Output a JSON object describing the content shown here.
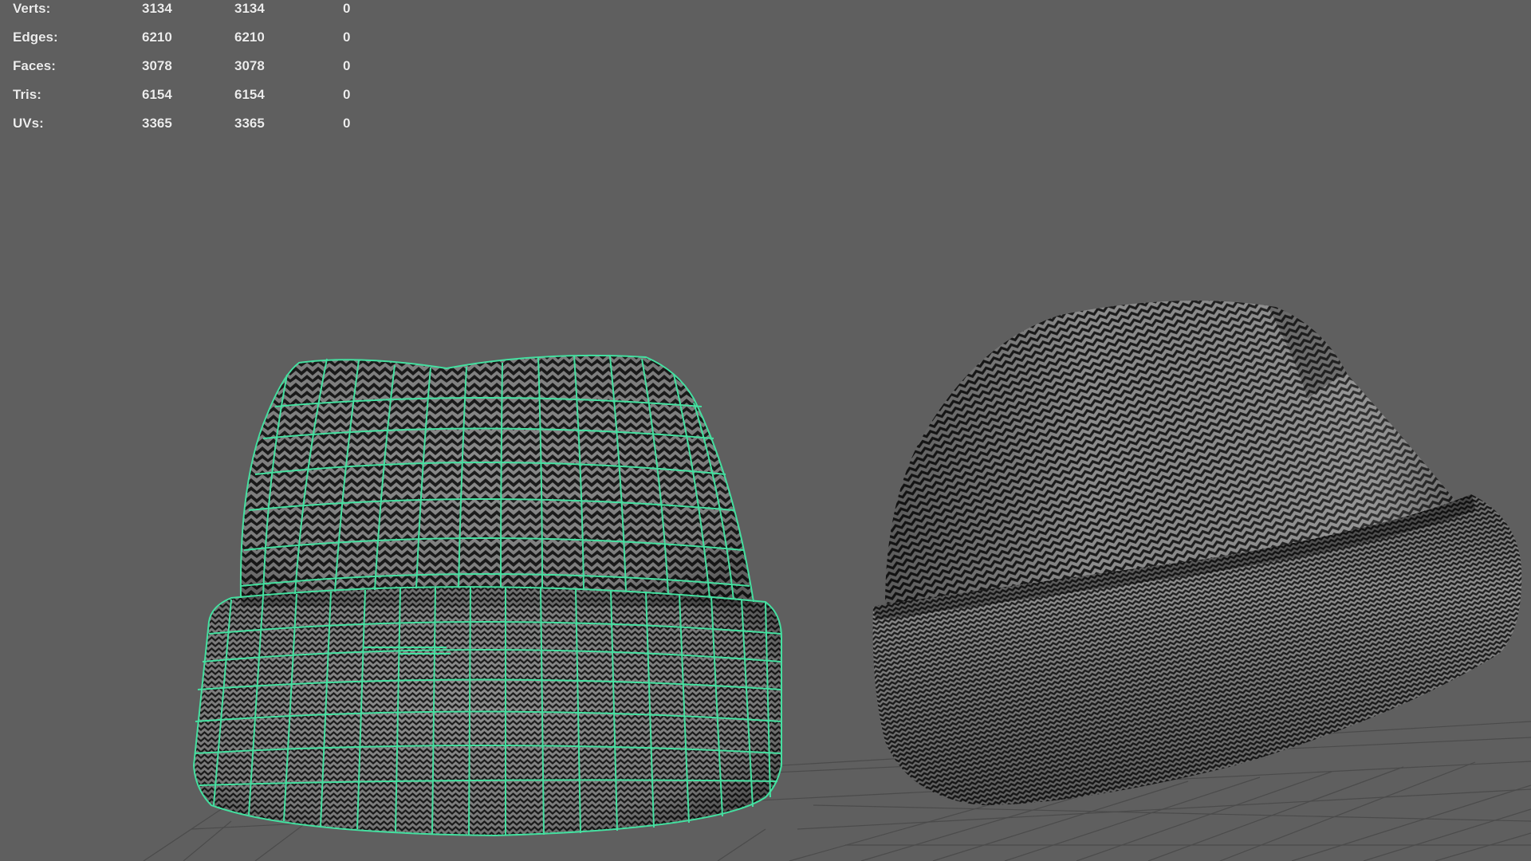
{
  "hud": {
    "rows": [
      {
        "label": "Verts:",
        "v1": "3134",
        "v2": "3134",
        "v3": "0"
      },
      {
        "label": "Edges:",
        "v1": "6210",
        "v2": "6210",
        "v3": "0"
      },
      {
        "label": "Faces:",
        "v1": "3078",
        "v2": "3078",
        "v3": "0"
      },
      {
        "label": "Tris:",
        "v1": "6154",
        "v2": "6154",
        "v3": "0"
      },
      {
        "label": "UVs:",
        "v1": "3365",
        "v2": "3365",
        "v3": "0"
      }
    ]
  },
  "colors": {
    "background": "#5f5f5f",
    "grid": "#4a4a4a",
    "wireframe": "#44e0a0",
    "pattern_dark": "#1a1a1a",
    "pattern_light": "#8c8c8c"
  },
  "objects": {
    "left": "beanie-wireframe-icon",
    "right": "beanie-shaded-icon"
  }
}
